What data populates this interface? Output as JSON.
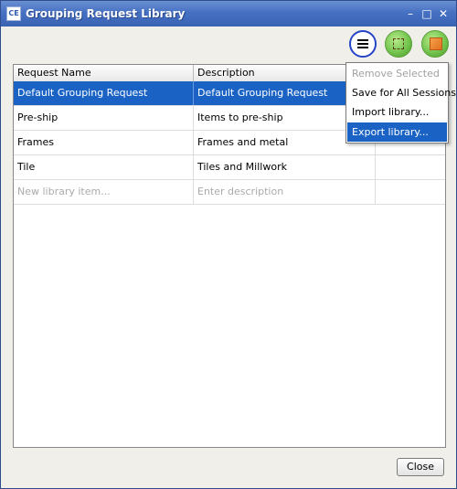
{
  "window": {
    "app_icon": "CE",
    "title": "Grouping Request Library",
    "controls": {
      "minimize": "–",
      "maximize": "□",
      "close": "✕"
    }
  },
  "toolbar": {
    "icons": [
      "menu-icon",
      "select-region-icon",
      "box-icon"
    ]
  },
  "table": {
    "columns": [
      "Request Name",
      "Description",
      ""
    ],
    "rows": [
      {
        "name": "Default Grouping Request",
        "description": "Default Grouping Request",
        "selected": true
      },
      {
        "name": "Pre-ship",
        "description": "Items to pre-ship",
        "selected": false
      },
      {
        "name": "Frames",
        "description": "Frames and metal",
        "selected": false
      },
      {
        "name": "Tile",
        "description": "Tiles and Millwork",
        "selected": false
      }
    ],
    "new_row": {
      "name_placeholder": "New library item...",
      "description_placeholder": "Enter description"
    }
  },
  "menu": {
    "items": [
      {
        "label": "Remove Selected",
        "state": "disabled"
      },
      {
        "label": "Save for All Sessions",
        "state": "normal"
      },
      {
        "label": "Import library...",
        "state": "normal"
      },
      {
        "label": "Export library...",
        "state": "highlighted"
      }
    ]
  },
  "footer": {
    "close_label": "Close"
  },
  "colors": {
    "selection": "#1a63c4",
    "titlebar": "#4670c2",
    "accent_button": "#2645c8",
    "green_button": "#6fc04a"
  }
}
